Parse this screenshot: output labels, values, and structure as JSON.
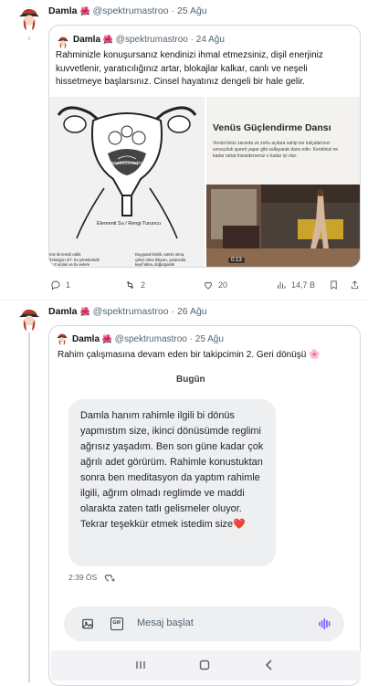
{
  "tweet1": {
    "name": "Damla",
    "handle": "@spektrumastroo",
    "date": "· 25 Ağu",
    "quote": {
      "name": "Damla",
      "handle": "@spektrumastroo",
      "date": "· 24 Ağu",
      "text": "Rahminizle konuşursanız kendinizi ihmal etmezsiniz, dişil enerjiniz kuvvetlenir, yaratıcılığınız artar, blokajlar kalkar, canlı ve neşeli hissetmeye başlarsınız. Cinsel hayatınız dengeli bir hale gelir.",
      "left_image": {
        "brand": "@spektrumastroo",
        "element_label": "Elementi Su / Rengi Turuncu",
        "left_caption": "nüz ile temsil edilir.\nfreksiyjon 2/7. Ev yöneticisidir.\nmuz acılan ve bu evlere\nrileşen gezegenler rahim\nkrosi hakkında bilgi verir",
        "right_caption": "Duygusal kimlik, tutmin olma,\nçekici olma ihtiyacı, yaratıcılık,\nkeyif alma, doğurganlık\nSorunu : Suçluluk duyma"
      },
      "right_image": {
        "title": "Venüs Güçlendirme Dansı",
        "body": "Venüs'ünüz zararda ve zorlu açılara sahip ise kalçalarınızı sonsuzluk işareti yapar gibi sallayarak dans edin. Kendinizi ne kadar rahat hissederseniz o kadar iyi olur.",
        "duration": "0:13"
      }
    },
    "actions": {
      "replies": "1",
      "retweets": "2",
      "likes": "20",
      "views": "14,7 B"
    }
  },
  "tweet2": {
    "name": "Damla",
    "handle": "@spektrumastroo",
    "date": "· 26 Ağu",
    "quote": {
      "name": "Damla",
      "handle": "@spektrumastroo",
      "date": "· 25 Ağu",
      "text": "Rahim çalışmasına devam eden bir takipcimin 2. Geri dönüşü 🌸"
    },
    "chat": {
      "day_label": "Bugün",
      "message": "Damla hanım rahimle ilgili bi dönüs yapmıstım size, ikinci dönüsümde reglimi ağrısız yaşadım. Ben son güne kadar çok ağrılı adet görürüm. Rahimle konustuktan sonra ben meditasyon da yaptım rahimle ilgili, ağrım olmadı reglimde ve maddi olarakta zaten tatlı gelismeler oluyor. Tekrar teşekkür etmek istedim size",
      "heart": "❤️",
      "time": "2:39 ÖS",
      "composer_placeholder": "Mesaj başlat",
      "gif_label": "GIF"
    }
  },
  "colors": {
    "muted": "#536471",
    "border": "#cfd9de",
    "accent_purple": "#7856ff",
    "rose": "#e0245e"
  }
}
